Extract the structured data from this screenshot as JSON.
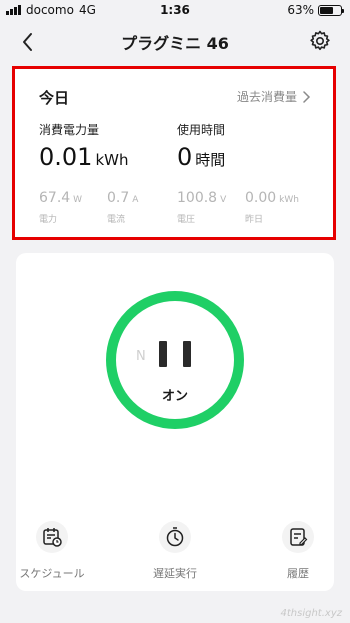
{
  "status_bar": {
    "carrier": "docomo",
    "network": "4G",
    "time": "1:36",
    "battery": "63%",
    "battery_level": 0.63
  },
  "nav": {
    "title": "プラグミニ 46",
    "back_icon": "chevron-left-icon",
    "settings_icon": "gear-icon"
  },
  "energy": {
    "period": "今日",
    "history_link": "過去消費量",
    "consumption": {
      "label": "消費電力量",
      "value": "0.01",
      "unit": "kWh"
    },
    "usage_time": {
      "label": "使用時間",
      "value": "0",
      "unit": "時間"
    },
    "stats": [
      {
        "value": "67.4",
        "unit": "W",
        "label": "電力"
      },
      {
        "value": "0.7",
        "unit": "A",
        "label": "電流"
      },
      {
        "value": "100.8",
        "unit": "V",
        "label": "電圧"
      },
      {
        "value": "0.00",
        "unit": "kWh",
        "label": "昨日"
      }
    ]
  },
  "device": {
    "neutral_label": "N",
    "power_state": "オン",
    "accent_color": "#1fcf66"
  },
  "actions": [
    {
      "label": "スケジュール",
      "icon": "calendar-clock-icon"
    },
    {
      "label": "遅延実行",
      "icon": "timer-icon"
    },
    {
      "label": "履歴",
      "icon": "history-log-icon"
    }
  ],
  "watermark": "4thsight.xyz"
}
